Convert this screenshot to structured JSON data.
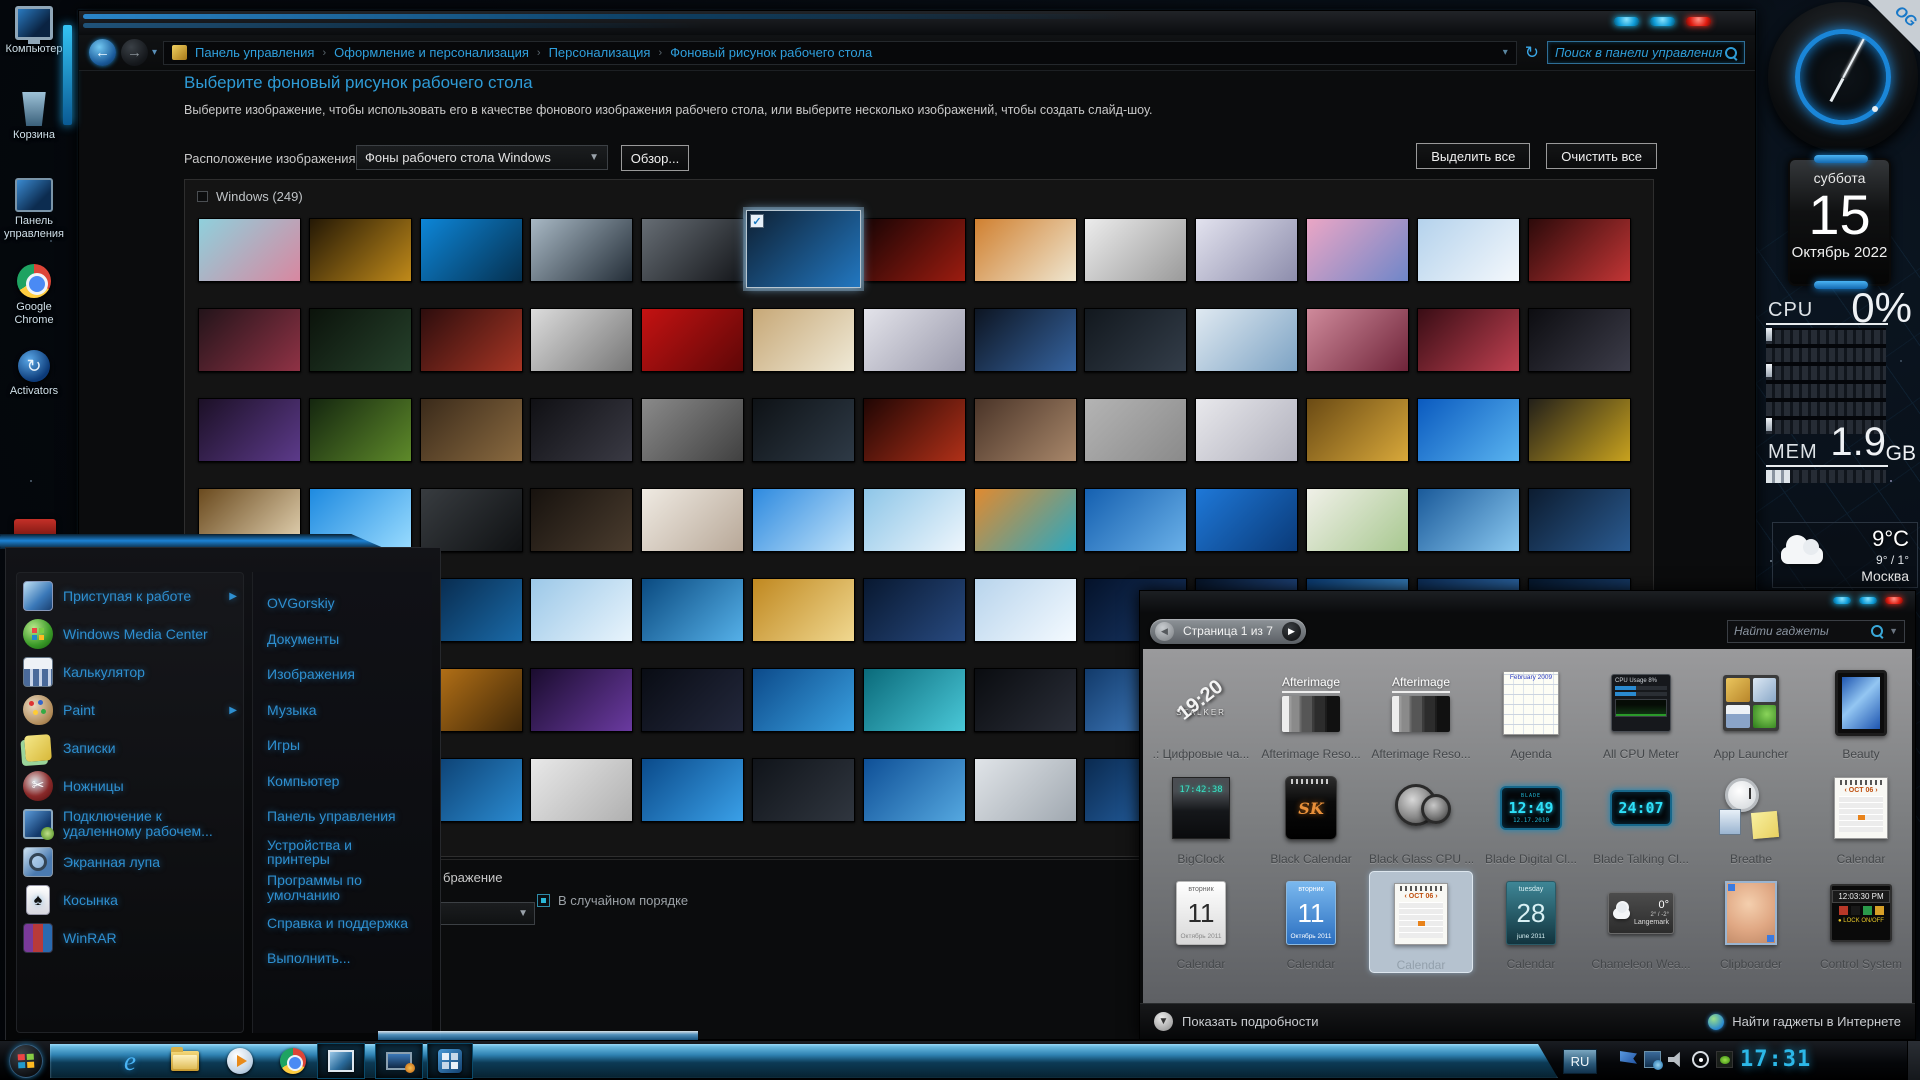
{
  "desktop": {
    "icons": [
      {
        "name": "computer",
        "label": "Компьютер"
      },
      {
        "name": "recycle-bin",
        "label": "Корзина"
      },
      {
        "name": "control-panel",
        "label": "Панель управления"
      },
      {
        "name": "chrome",
        "label": "Google Chrome"
      },
      {
        "name": "activators",
        "label": "Activators"
      }
    ]
  },
  "control_panel": {
    "breadcrumb": [
      "Панель управления",
      "Оформление и персонализация",
      "Персонализация",
      "Фоновый рисунок рабочего стола"
    ],
    "search_placeholder": "Поиск в панели управления",
    "heading": "Выберите фоновый рисунок рабочего стола",
    "subheading": "Выберите изображение, чтобы использовать его в качестве фонового изображения рабочего стола, или выберите несколько изображений, чтобы создать слайд-шоу.",
    "location_label": "Расположение изображения:",
    "location_value": "Фоны рабочего стола Windows",
    "browse_button": "Обзор...",
    "select_all_button": "Выделить все",
    "clear_all_button": "Очистить все",
    "group_title": "Windows (249)",
    "position_fragment": "бражение",
    "shuffle_label": "В случайном порядке"
  },
  "wallpapers": {
    "selected": {
      "row": 0,
      "col": 5
    },
    "rows": [
      [
        [
          "#8fd0dc",
          "#d887a0"
        ],
        [
          "#241805",
          "#c08a1a"
        ],
        [
          "#0d86d8",
          "#05304f"
        ],
        [
          "#a8b8c4",
          "#242e38"
        ],
        [
          "#666d74",
          "#14161a"
        ],
        [
          "#0e2033",
          "#2277c0"
        ],
        [
          "#190404",
          "#9c1c10"
        ],
        [
          "#d08030",
          "#efe6d0"
        ],
        [
          "#ececec",
          "#9a9a9a"
        ],
        [
          "#e2e2ee",
          "#8d8dac"
        ],
        [
          "#eba6c5",
          "#6f86c8"
        ],
        [
          "#b4d2ec",
          "#f4f8fc"
        ],
        [
          "#2c0a0a",
          "#c23535"
        ]
      ],
      [
        [
          "#23141a",
          "#8f3245"
        ],
        [
          "#0b130b",
          "#26412b"
        ],
        [
          "#2d0d0d",
          "#a63524"
        ],
        [
          "#dcdcdc",
          "#767676"
        ],
        [
          "#c41212",
          "#5e0707"
        ],
        [
          "#c7a877",
          "#efe9d6"
        ],
        [
          "#e3e3ea",
          "#9a9aac"
        ],
        [
          "#0d1522",
          "#35639f"
        ],
        [
          "#12181e",
          "#333d49"
        ],
        [
          "#dfe9f1",
          "#7da3c4"
        ],
        [
          "#cf8a9b",
          "#6f2439"
        ],
        [
          "#390d15",
          "#bf4050"
        ],
        [
          "#0d0d11",
          "#3c3c49"
        ]
      ],
      [
        [
          "#1c1026",
          "#5c3a8a"
        ],
        [
          "#14260f",
          "#5e8a2a"
        ],
        [
          "#3a2a1a",
          "#8a6a40"
        ],
        [
          "#101014",
          "#3a3a44"
        ],
        [
          "#8a8a8a",
          "#404040"
        ],
        [
          "#0e1216",
          "#2e3a46"
        ],
        [
          "#200604",
          "#b03018"
        ],
        [
          "#4a3428",
          "#a8876a"
        ],
        [
          "#b4b4b4",
          "#8a8a8a"
        ],
        [
          "#e8e8ec",
          "#b0b0bc"
        ],
        [
          "#6a4a14",
          "#d8a83a"
        ],
        [
          "#0a5abf",
          "#5ab4f0"
        ],
        [
          "#23201a",
          "#c8a21e"
        ]
      ],
      [
        [
          "#6a4a1e",
          "#e8d8b8"
        ],
        [
          "#1e8ae0",
          "#9adcff"
        ],
        [
          "#383c40",
          "#0f1113"
        ],
        [
          "#17120e",
          "#4a3c2e"
        ],
        [
          "#efeae2",
          "#b8a898"
        ],
        [
          "#2e8adf",
          "#bfe2fa"
        ],
        [
          "#8ec6e8",
          "#eef6fc"
        ],
        [
          "#e08a30",
          "#2aa8c0"
        ],
        [
          "#1560b0",
          "#6ab0e8"
        ],
        [
          "#1e78d8",
          "#0a3a78"
        ],
        [
          "#f0f0e8",
          "#a8c890"
        ],
        [
          "#1a5a9a",
          "#8ac8f0"
        ],
        [
          "#0c1c30",
          "#2a5a90"
        ]
      ],
      [
        [
          "#0a2a50",
          "#3a8ad0"
        ],
        [
          "#0c3a66",
          "#4aa0d8"
        ],
        [
          "#062444",
          "#1a6aa8"
        ],
        [
          "#9cc8e8",
          "#e8f4fc"
        ],
        [
          "#0a4a80",
          "#55b0e8"
        ],
        [
          "#c08820",
          "#f0d890"
        ],
        [
          "#081830",
          "#284a80"
        ],
        [
          "#b8d4ec",
          "#f4faff"
        ],
        [
          "#04122a",
          "#1a3a6a"
        ],
        [
          "#061428",
          "#2a5aa0"
        ],
        [
          "#0a3a70",
          "#4a9ad8"
        ],
        [
          "#0c2c55",
          "#3a80c8"
        ],
        [
          "#06182e",
          "#1e4a80"
        ]
      ],
      [
        [
          "#4aa0d8",
          "#b8e0f8"
        ],
        [
          "#0a2a55",
          "#3a7ac0"
        ],
        [
          "#c07818",
          "#402808"
        ],
        [
          "#1a0c2e",
          "#6a3aa0"
        ],
        [
          "#090c14",
          "#23283c"
        ],
        [
          "#0c4a8a",
          "#3aa0e0"
        ],
        [
          "#0a6a7a",
          "#4ac8d8"
        ],
        [
          "#0a0c10",
          "#2a2e38"
        ],
        [
          "#123a6a",
          "#4a8ad0"
        ],
        [
          "#0a2440",
          "#2a6aa8"
        ],
        [
          "#0c3058",
          "#3a88c8"
        ],
        [
          "#082040",
          "#1a5a9a"
        ],
        [
          "#0a2a4a",
          "#3a7ab8"
        ]
      ],
      [
        [
          "#2a6aa8",
          "#6ab0e0"
        ],
        [
          "#10141a",
          "#2a3040"
        ],
        [
          "#0a3a6a",
          "#2a8ad0"
        ],
        [
          "#e8e8e8",
          "#b0b0b0"
        ],
        [
          "#0a4a8a",
          "#3aa0e8"
        ],
        [
          "#10141a",
          "#30363f"
        ],
        [
          "#0e4f96",
          "#55a8e0"
        ],
        [
          "#e0e4e8",
          "#a0a8b0"
        ],
        [
          "#0a2a50",
          "#2a6ab0"
        ],
        [
          "#101820",
          "#2a3a4a"
        ],
        [
          "#0c3c70",
          "#3a8ad0"
        ],
        [
          "#08141f",
          "#1a3a5a"
        ],
        [
          "#2a80c8",
          "#88c8f0"
        ]
      ]
    ]
  },
  "start_menu": {
    "left_items": [
      {
        "icon": "getting-started",
        "label": "Приступая к работе",
        "submenu": true
      },
      {
        "icon": "wmc",
        "label": "Windows Media Center",
        "submenu": false
      },
      {
        "icon": "calculator",
        "label": "Калькулятор",
        "submenu": false
      },
      {
        "icon": "paint",
        "label": "Paint",
        "submenu": true
      },
      {
        "icon": "notes",
        "label": "Записки",
        "submenu": false
      },
      {
        "icon": "snipping",
        "label": "Ножницы",
        "submenu": false
      },
      {
        "icon": "rdp",
        "label": "Подключение к удаленному рабочем...",
        "submenu": false
      },
      {
        "icon": "magnifier",
        "label": "Экранная лупа",
        "submenu": false
      },
      {
        "icon": "solitaire",
        "label": "Косынка",
        "submenu": false
      },
      {
        "icon": "winrar",
        "label": "WinRAR",
        "submenu": false
      }
    ],
    "right_items": [
      "OVGorskiy",
      "Документы",
      "Изображения",
      "Музыка",
      "Игры",
      "Компьютер",
      "Панель управления",
      "Устройства и принтеры",
      "Программы по умолчанию",
      "Справка и поддержка",
      "Выполнить..."
    ]
  },
  "gadgets_window": {
    "page_label": "Страница 1 из 7",
    "search_placeholder": "Найти гаджеты",
    "show_details": "Показать подробности",
    "find_online": "Найти гаджеты в Интернете",
    "items": [
      {
        "label": ".: Цифровые ча...",
        "type": "stalker",
        "text": "19:20",
        "sub": "STALKER"
      },
      {
        "label": "Afterimage Reso...",
        "type": "afterimage",
        "text": "Afterimage"
      },
      {
        "label": "Afterimage Reso...",
        "type": "afterimage",
        "text": "Afterimage"
      },
      {
        "label": "Agenda",
        "type": "agenda",
        "text": "February 2009"
      },
      {
        "label": "All CPU Meter",
        "type": "cpumeter",
        "text": "CPU Usage"
      },
      {
        "label": "App Launcher",
        "type": "applauncher"
      },
      {
        "label": "Beauty",
        "type": "beauty"
      },
      {
        "label": "BigClock",
        "type": "bigclock",
        "text": "17:42:38"
      },
      {
        "label": "Black Calendar",
        "type": "blackcal",
        "text": "SK"
      },
      {
        "label": "Black Glass CPU ...",
        "type": "gauges"
      },
      {
        "label": "Blade Digital Cl...",
        "type": "blade1",
        "top": "BLADE",
        "text": "12:49",
        "sub": "12.17.2010"
      },
      {
        "label": "Blade Talking Cl...",
        "type": "blade2",
        "text": "24:07"
      },
      {
        "label": "Breathe",
        "type": "breathe"
      },
      {
        "label": "Calendar",
        "type": "papercal",
        "text": "OCT 06"
      },
      {
        "label": "Calendar",
        "type": "whitecal",
        "top": "вторник",
        "text": "11",
        "bottom": "Октябрь 2011"
      },
      {
        "label": "Calendar",
        "type": "bluecal",
        "top": "вторник",
        "text": "11",
        "bottom": "Октябрь 2011"
      },
      {
        "label": "Calendar",
        "type": "papercal",
        "text": "OCT 06",
        "selected": true
      },
      {
        "label": "Calendar",
        "type": "tealcal",
        "top": "tuesday",
        "text": "28",
        "bottom": "june 2011"
      },
      {
        "label": "Chameleon Wea...",
        "type": "chamweather",
        "text": "0°",
        "sub": "2° / -2°",
        "bottom": "Langemark"
      },
      {
        "label": "Clipboarder",
        "type": "baby"
      },
      {
        "label": "Control System",
        "type": "control",
        "text": "12:03:30 PM",
        "sub": "LOCK ON/OFF"
      }
    ]
  },
  "sidebar": {
    "calendar": {
      "weekday": "суббота",
      "day": "15",
      "month": "Октябрь 2022"
    },
    "performance": {
      "cpu_label": "CPU",
      "cpu_value": "0%",
      "mem_label": "MEM",
      "mem_value": "1.9",
      "mem_unit": "GB"
    },
    "weather": {
      "temp": "9°C",
      "range": "9° / 1°",
      "city": "Москва"
    }
  },
  "taskbar": {
    "language": "RU",
    "time": "17:31",
    "items": [
      {
        "name": "start",
        "pressed": false
      },
      {
        "name": "ie",
        "pressed": false
      },
      {
        "name": "explorer",
        "pressed": false
      },
      {
        "name": "wmp",
        "pressed": false
      },
      {
        "name": "chrome",
        "pressed": false
      },
      {
        "name": "image-viewer",
        "pressed": true
      },
      {
        "name": "personalization",
        "pressed": true
      },
      {
        "name": "gadgets",
        "pressed": true
      }
    ],
    "tray_icons": [
      "action-center-flag",
      "network",
      "volume",
      "wireless",
      "nvidia"
    ]
  }
}
